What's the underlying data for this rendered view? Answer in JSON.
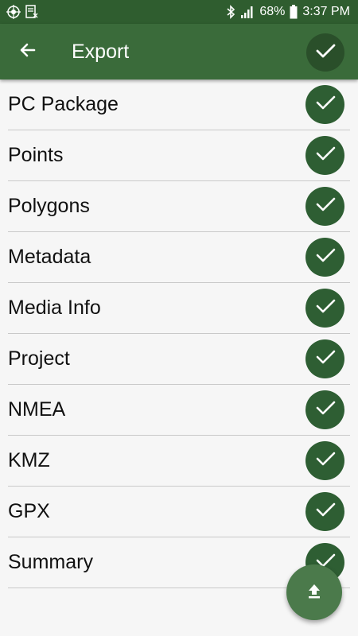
{
  "status_bar": {
    "battery": "68%",
    "time": "3:37 PM",
    "left_icons": [
      "app-logo-icon",
      "note-icon"
    ],
    "right_icons": [
      "bluetooth-icon",
      "signal-icon",
      "battery-icon"
    ]
  },
  "app_bar": {
    "title": "Export",
    "back_icon": "arrow-left-icon",
    "confirm_icon": "check-icon"
  },
  "export_items": [
    {
      "label": "PC Package",
      "checked": true
    },
    {
      "label": "Points",
      "checked": true
    },
    {
      "label": "Polygons",
      "checked": true
    },
    {
      "label": "Metadata",
      "checked": true
    },
    {
      "label": "Media Info",
      "checked": true
    },
    {
      "label": "Project",
      "checked": true
    },
    {
      "label": "NMEA",
      "checked": true
    },
    {
      "label": "KMZ",
      "checked": true
    },
    {
      "label": "GPX",
      "checked": true
    },
    {
      "label": "Summary",
      "checked": true
    }
  ],
  "fab": {
    "icon": "upload-icon"
  },
  "colors": {
    "status_bar": "#2f5d2f",
    "app_bar": "#3a6b3a",
    "check_circle": "#2e5e33",
    "fab": "#4b7a4b",
    "background": "#f6f6f6"
  }
}
